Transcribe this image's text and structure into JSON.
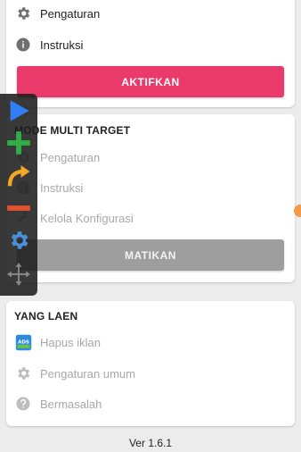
{
  "top_card": {
    "items": [
      {
        "label": "Pengaturan",
        "icon": "gear-icon"
      },
      {
        "label": "Instruksi",
        "icon": "info-icon"
      }
    ],
    "button": "AKTIFKAN"
  },
  "multi_target": {
    "title": "MODE MULTI TARGET",
    "items": [
      {
        "label": "Pengaturan",
        "icon": "gear-icon"
      },
      {
        "label": "Instruksi",
        "icon": "info-icon"
      },
      {
        "label": "Kelola Konfigurasi",
        "icon": "wrench-icon"
      }
    ],
    "button": "MATIKAN"
  },
  "others": {
    "title": "YANG LAEN",
    "items": [
      {
        "label": "Hapus iklan",
        "icon": "ads-icon"
      },
      {
        "label": "Pengaturan umum",
        "icon": "gear-icon"
      },
      {
        "label": "Bermasalah",
        "icon": "help-icon"
      }
    ]
  },
  "version": "Ver 1.6.1",
  "floating_toolbar": {
    "buttons": [
      "play-icon",
      "add-icon",
      "redo-icon",
      "remove-icon",
      "gear-icon",
      "move-icon"
    ]
  },
  "colors": {
    "accent": "#ea3a6b",
    "disabled": "#9e9e9e",
    "play": "#2f7ef5",
    "add": "#2fae47",
    "redo": "#f5a623",
    "remove": "#e0522f"
  }
}
